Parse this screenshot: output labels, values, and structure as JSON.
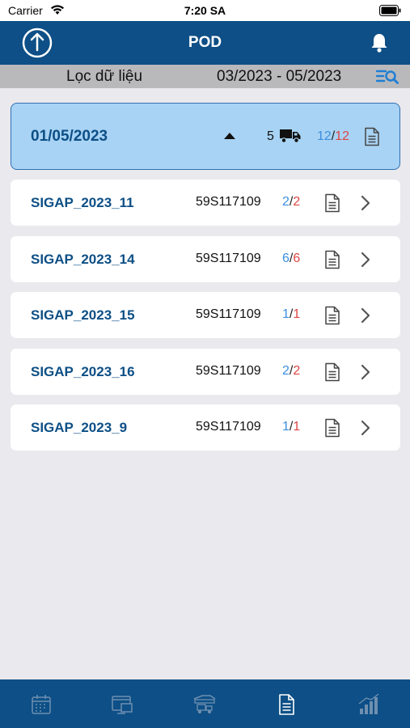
{
  "status_bar": {
    "carrier": "Carrier",
    "time": "7:20 SA"
  },
  "nav": {
    "title": "POD"
  },
  "filter": {
    "label": "Lọc dữ liệu",
    "range": "03/2023 - 05/2023"
  },
  "group": {
    "date": "01/05/2023",
    "truck_count": "5",
    "done": "12",
    "total": "12"
  },
  "rows": [
    {
      "code": "SIGAP_2023_11",
      "plate": "59S117109",
      "done": "2",
      "total": "2"
    },
    {
      "code": "SIGAP_2023_14",
      "plate": "59S117109",
      "done": "6",
      "total": "6"
    },
    {
      "code": "SIGAP_2023_15",
      "plate": "59S117109",
      "done": "1",
      "total": "1"
    },
    {
      "code": "SIGAP_2023_16",
      "plate": "59S117109",
      "done": "2",
      "total": "2"
    },
    {
      "code": "SIGAP_2023_9",
      "plate": "59S117109",
      "done": "1",
      "total": "1"
    }
  ],
  "ratio_separator": "/",
  "colors": {
    "primary": "#0d4f86",
    "done": "#3b8fe0",
    "total": "#e04545",
    "group_bg": "#a8d3f4"
  },
  "tabs": [
    {
      "icon": "calendar-icon",
      "active": false
    },
    {
      "icon": "monitor-icon",
      "active": false
    },
    {
      "icon": "trucks-icon",
      "active": false
    },
    {
      "icon": "document-icon",
      "active": true
    },
    {
      "icon": "chart-icon",
      "active": false
    }
  ]
}
